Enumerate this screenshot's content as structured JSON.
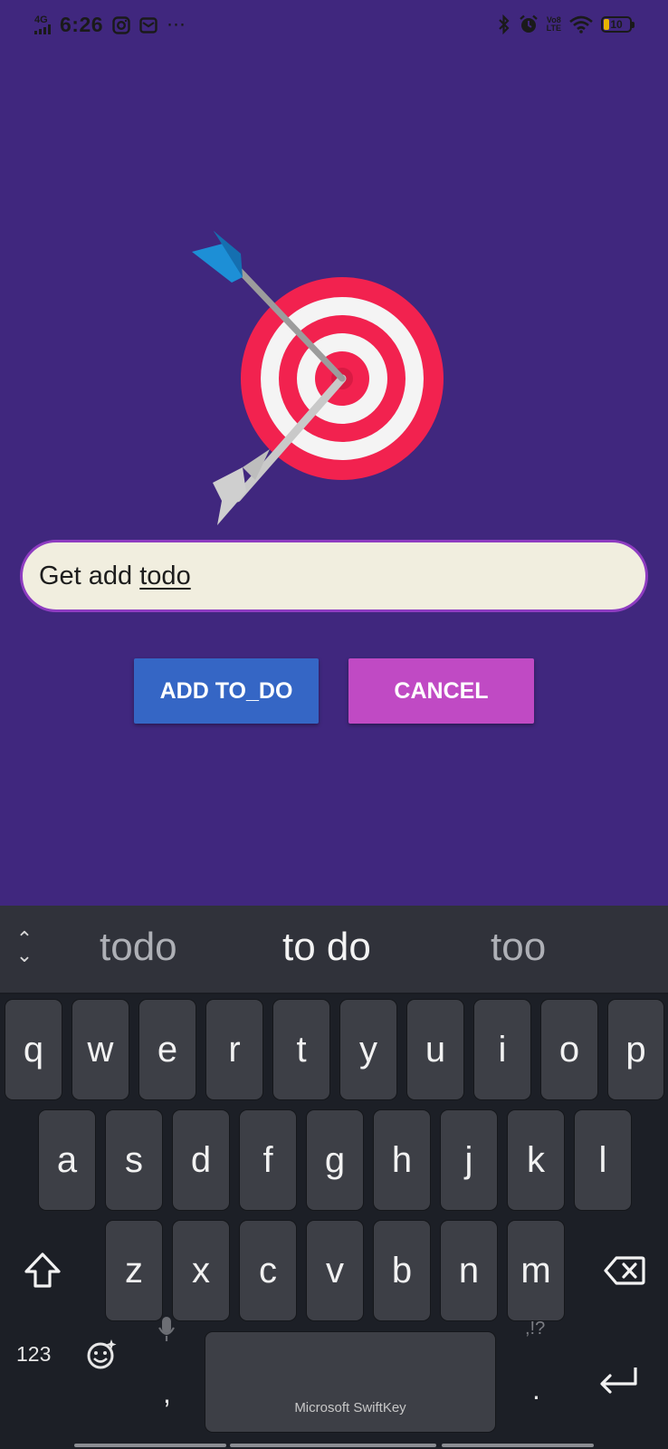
{
  "status_bar": {
    "network": "4G",
    "time": "6:26",
    "volte": "Vo8\nLTE",
    "battery": "10",
    "icons_left": [
      "instagram-icon",
      "mail-icon",
      "more-icon"
    ],
    "icons_right": [
      "bluetooth-icon",
      "alarm-icon",
      "volte-icon",
      "wifi-icon",
      "battery-icon"
    ]
  },
  "illustration": {
    "name": "target-with-arrow",
    "colors": {
      "ring": "#f2224f",
      "inner": "#f4f4f4",
      "fletching": "#1d8fd6",
      "tail": "#cccccc"
    }
  },
  "todo_input": {
    "value_plain": "Get add ",
    "value_underlined": "todo"
  },
  "buttons": {
    "add": "ADD TO_DO",
    "cancel": "CANCEL"
  },
  "keyboard": {
    "suggestions": [
      "todo",
      "to do",
      "too"
    ],
    "row1": [
      "q",
      "w",
      "e",
      "r",
      "t",
      "y",
      "u",
      "i",
      "o",
      "p"
    ],
    "row2": [
      "a",
      "s",
      "d",
      "f",
      "g",
      "h",
      "j",
      "k",
      "l"
    ],
    "row3": [
      "z",
      "x",
      "c",
      "v",
      "b",
      "n",
      "m"
    ],
    "numbers_key": "123",
    "comma": ",",
    "period": ".",
    "punct_hint": ",!?",
    "space_label": "Microsoft SwiftKey"
  },
  "colors": {
    "background": "#40277e",
    "input_bg": "#f1eedf",
    "input_border": "#8e3cc1",
    "add_button": "#3566c5",
    "cancel_button": "#c04ac4",
    "keyboard_bg": "#1c1f26",
    "key_bg": "#3d3f46"
  }
}
